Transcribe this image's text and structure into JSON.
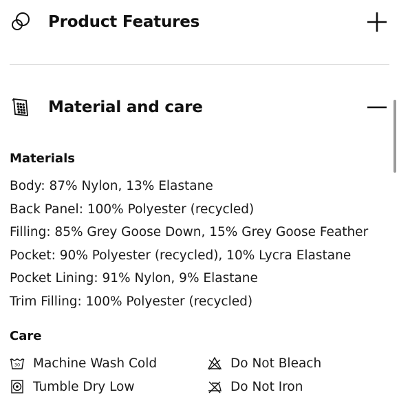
{
  "sections": {
    "product_features": {
      "title": "Product Features",
      "icon": "overlapping-circles-icon",
      "toggle": "plus-icon"
    },
    "material_care": {
      "title": "Material and care",
      "icon": "fabric-swatch-icon",
      "toggle": "minus-icon"
    }
  },
  "materials": {
    "heading": "Materials",
    "items": [
      "Body: 87% Nylon, 13% Elastane",
      "Back Panel: 100% Polyester (recycled)",
      "Filling: 85% Grey Goose Down, 15% Grey Goose Feather",
      "Pocket: 90% Polyester (recycled), 10% Lycra Elastane",
      "Pocket Lining: 91% Nylon, 9% Elastane",
      "Trim Filling: 100% Polyester (recycled)"
    ]
  },
  "care": {
    "heading": "Care",
    "items": [
      {
        "label": "Machine Wash Cold",
        "icon": "wash-tub-30-icon"
      },
      {
        "label": "Do Not Bleach",
        "icon": "no-bleach-triangle-icon"
      },
      {
        "label": "Tumble Dry Low",
        "icon": "tumble-dry-low-icon"
      },
      {
        "label": "Do Not Iron",
        "icon": "no-iron-icon"
      }
    ]
  }
}
